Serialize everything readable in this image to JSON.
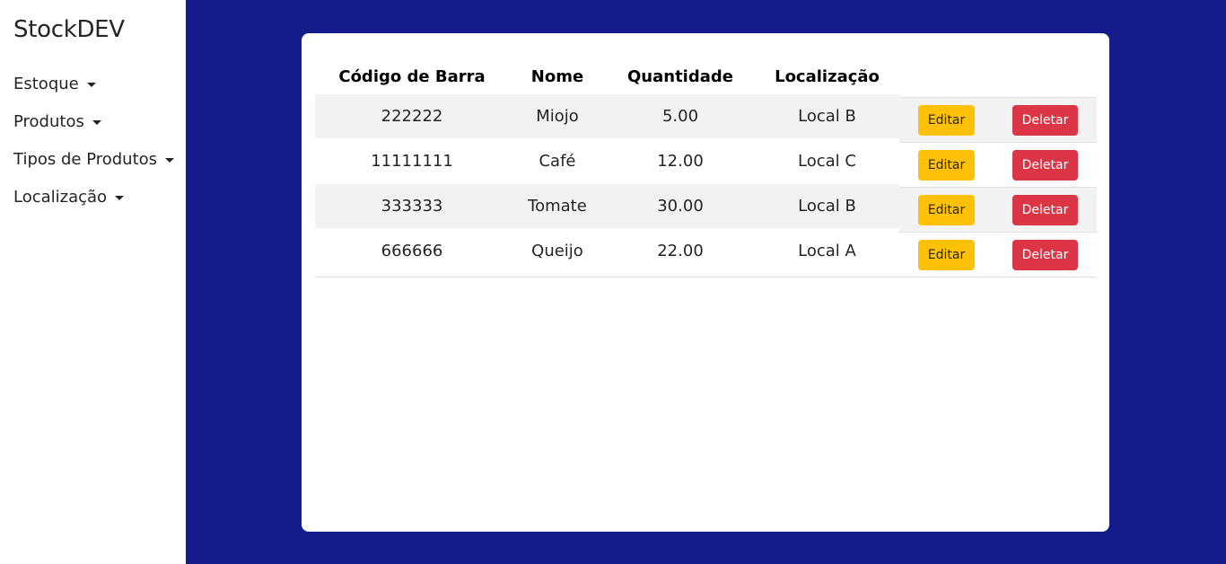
{
  "sidebar": {
    "brand": "StockDEV",
    "items": [
      {
        "label": "Estoque"
      },
      {
        "label": "Produtos"
      },
      {
        "label": "Tipos de Produtos"
      },
      {
        "label": "Localização"
      }
    ]
  },
  "table": {
    "headers": {
      "code": "Código de Barra",
      "name": "Nome",
      "quantity": "Quantidade",
      "location": "Localização"
    },
    "rows": [
      {
        "code": "222222",
        "name": "Miojo",
        "quantity": "5.00",
        "location": "Local B"
      },
      {
        "code": "11111111",
        "name": "Café",
        "quantity": "12.00",
        "location": "Local C"
      },
      {
        "code": "333333",
        "name": "Tomate",
        "quantity": "30.00",
        "location": "Local B"
      },
      {
        "code": "666666",
        "name": "Queijo",
        "quantity": "22.00",
        "location": "Local A"
      }
    ],
    "edit_label": "Editar",
    "delete_label": "Deletar"
  },
  "colors": {
    "main_background": "#151b8a",
    "edit_button": "#ffc107",
    "delete_button": "#dc3545"
  }
}
